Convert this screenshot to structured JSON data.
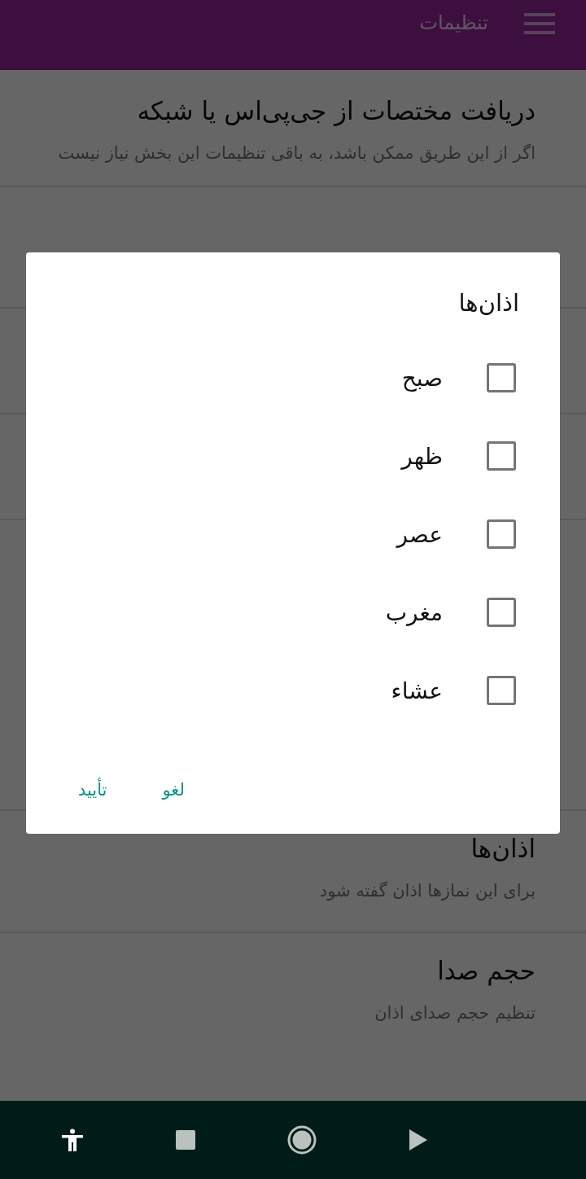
{
  "app_bar": {
    "title": "تنظیمات"
  },
  "settings": [
    {
      "kind": "text",
      "title": "دریافت مختصات از جی‌پی‌اس یا شبکه",
      "subtitle": "اگر از این طریق ممکن باشد، به باقی تنظیمات این بخش نیاز نیست"
    },
    {
      "kind": "text",
      "title": "اذان‌ها",
      "subtitle": "برای این نمازها اذان گفته شود"
    },
    {
      "kind": "text",
      "title": "حجم صدا",
      "subtitle": "تنظیم حجم صدای اذان"
    }
  ],
  "dialog": {
    "title": "اذان‌ها",
    "options": [
      {
        "label": "صبح",
        "checked": false
      },
      {
        "label": "ظهر",
        "checked": false
      },
      {
        "label": "عصر",
        "checked": false
      },
      {
        "label": "مغرب",
        "checked": false
      },
      {
        "label": "عشاء",
        "checked": false
      }
    ],
    "buttons": [
      "لغو",
      "تأیید"
    ]
  }
}
